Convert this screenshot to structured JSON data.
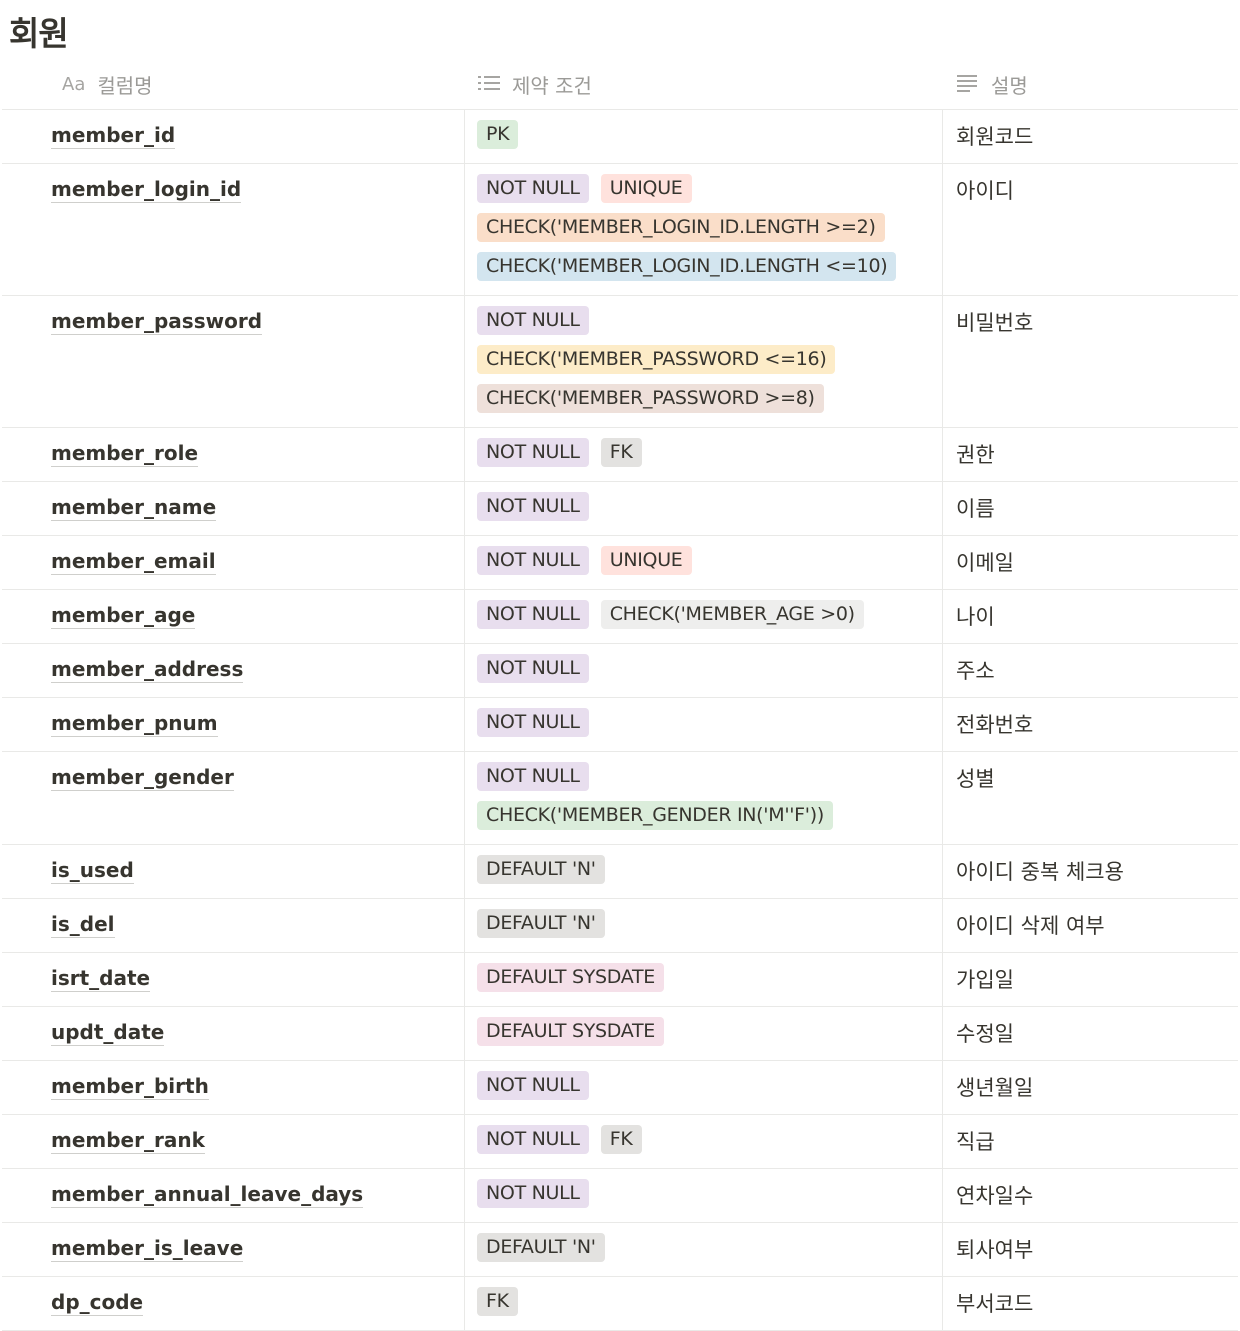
{
  "page": {
    "title": "회원"
  },
  "columns": {
    "name": {
      "icon": "text-property-icon",
      "label": "컬럼명",
      "icon_text": "Aa"
    },
    "constraints": {
      "icon": "list-icon",
      "label": "제약 조건"
    },
    "description": {
      "icon": "text-lines-icon",
      "label": "설명"
    }
  },
  "tag_colors": {
    "purple": "#e8deee",
    "red": "#ffe2dd",
    "orange": "#fadec9",
    "blue": "#d3e5ef",
    "yellow": "#fdecc8",
    "brown": "#eee0da",
    "gray": "#e3e2e0",
    "green": "#dbeddb",
    "pink": "#f5e0e9",
    "default": "#eeeeed"
  },
  "rows": [
    {
      "name": "member_id",
      "description": "회원코드",
      "tags": [
        [
          {
            "text": "PK",
            "color": "green"
          }
        ]
      ]
    },
    {
      "name": "member_login_id",
      "description": "아이디",
      "tags": [
        [
          {
            "text": "NOT NULL",
            "color": "purple"
          },
          {
            "text": "UNIQUE",
            "color": "red"
          }
        ],
        [
          {
            "text": "CHECK('MEMBER_LOGIN_ID.LENGTH >=2)",
            "color": "orange"
          }
        ],
        [
          {
            "text": "CHECK('MEMBER_LOGIN_ID.LENGTH <=10)",
            "color": "blue"
          }
        ]
      ]
    },
    {
      "name": "member_password",
      "description": "비밀번호",
      "tags": [
        [
          {
            "text": "NOT NULL",
            "color": "purple"
          }
        ],
        [
          {
            "text": "CHECK('MEMBER_PASSWORD <=16)",
            "color": "yellow"
          }
        ],
        [
          {
            "text": "CHECK('MEMBER_PASSWORD >=8)",
            "color": "brown"
          }
        ]
      ]
    },
    {
      "name": "member_role",
      "description": "권한",
      "tags": [
        [
          {
            "text": "NOT NULL",
            "color": "purple"
          },
          {
            "text": "FK",
            "color": "gray"
          }
        ]
      ]
    },
    {
      "name": "member_name",
      "description": "이름",
      "tags": [
        [
          {
            "text": "NOT NULL",
            "color": "purple"
          }
        ]
      ]
    },
    {
      "name": "member_email",
      "description": "이메일",
      "tags": [
        [
          {
            "text": "NOT NULL",
            "color": "purple"
          },
          {
            "text": "UNIQUE",
            "color": "red"
          }
        ]
      ]
    },
    {
      "name": "member_age",
      "description": "나이",
      "tags": [
        [
          {
            "text": "NOT NULL",
            "color": "purple"
          },
          {
            "text": "CHECK('MEMBER_AGE >0)",
            "color": "default"
          }
        ]
      ]
    },
    {
      "name": "member_address",
      "description": "주소",
      "tags": [
        [
          {
            "text": "NOT NULL",
            "color": "purple"
          }
        ]
      ]
    },
    {
      "name": "member_pnum",
      "description": "전화번호",
      "tags": [
        [
          {
            "text": "NOT NULL",
            "color": "purple"
          }
        ]
      ]
    },
    {
      "name": "member_gender",
      "description": "성별",
      "tags": [
        [
          {
            "text": "NOT NULL",
            "color": "purple"
          }
        ],
        [
          {
            "text": "CHECK('MEMBER_GENDER IN('M''F'))",
            "color": "green"
          }
        ]
      ]
    },
    {
      "name": "is_used",
      "description": "아이디 중복 체크용",
      "tags": [
        [
          {
            "text": "DEFAULT 'N'",
            "color": "gray"
          }
        ]
      ]
    },
    {
      "name": "is_del",
      "description": "아이디 삭제 여부",
      "tags": [
        [
          {
            "text": "DEFAULT 'N'",
            "color": "gray"
          }
        ]
      ]
    },
    {
      "name": "isrt_date",
      "description": "가입일",
      "tags": [
        [
          {
            "text": "DEFAULT SYSDATE",
            "color": "pink"
          }
        ]
      ]
    },
    {
      "name": "updt_date",
      "description": "수정일",
      "tags": [
        [
          {
            "text": "DEFAULT SYSDATE",
            "color": "pink"
          }
        ]
      ]
    },
    {
      "name": "member_birth",
      "description": "생년월일",
      "tags": [
        [
          {
            "text": "NOT NULL",
            "color": "purple"
          }
        ]
      ]
    },
    {
      "name": "member_rank",
      "description": "직급",
      "tags": [
        [
          {
            "text": "NOT NULL",
            "color": "purple"
          },
          {
            "text": "FK",
            "color": "gray"
          }
        ]
      ]
    },
    {
      "name": "member_annual_leave_days",
      "description": "연차일수",
      "tags": [
        [
          {
            "text": "NOT NULL",
            "color": "purple"
          }
        ]
      ]
    },
    {
      "name": "member_is_leave",
      "description": "퇴사여부",
      "tags": [
        [
          {
            "text": "DEFAULT 'N'",
            "color": "gray"
          }
        ]
      ]
    },
    {
      "name": "dp_code",
      "description": "부서코드",
      "tags": [
        [
          {
            "text": "FK",
            "color": "gray"
          }
        ]
      ]
    }
  ]
}
